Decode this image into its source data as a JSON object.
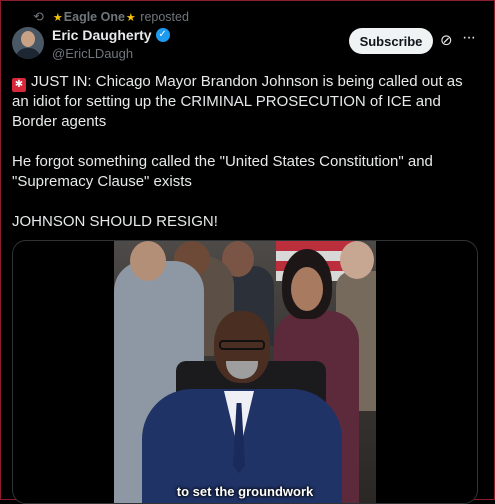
{
  "repost": {
    "user": "Eagle One",
    "label": "reposted"
  },
  "author": {
    "name": "Eric Daugherty",
    "handle": "@EricLDaugh",
    "verified": true
  },
  "actions": {
    "subscribe_label": "Subscribe",
    "more_label": "···"
  },
  "tweet": {
    "paragraph1": "JUST IN: Chicago Mayor Brandon Johnson is being called out as an idiot for setting up the CRIMINAL PROSECUTION of ICE and Border agents",
    "paragraph2": "He forgot something called the \"United States Constitution\" and \"Supremacy Clause\" exists",
    "paragraph3": "JOHNSON SHOULD RESIGN!"
  },
  "video": {
    "caption": "to set the groundwork"
  },
  "colors": {
    "background": "#000000",
    "text": "#e7e9ea",
    "muted": "#71767b",
    "verified": "#1d9bf0",
    "subscribe_bg": "#eff3f4",
    "star": "#f4c20d"
  },
  "icons": [
    "repost-icon",
    "star-icon",
    "verified-badge-icon",
    "grok-icon",
    "more-icon",
    "siren-icon"
  ]
}
